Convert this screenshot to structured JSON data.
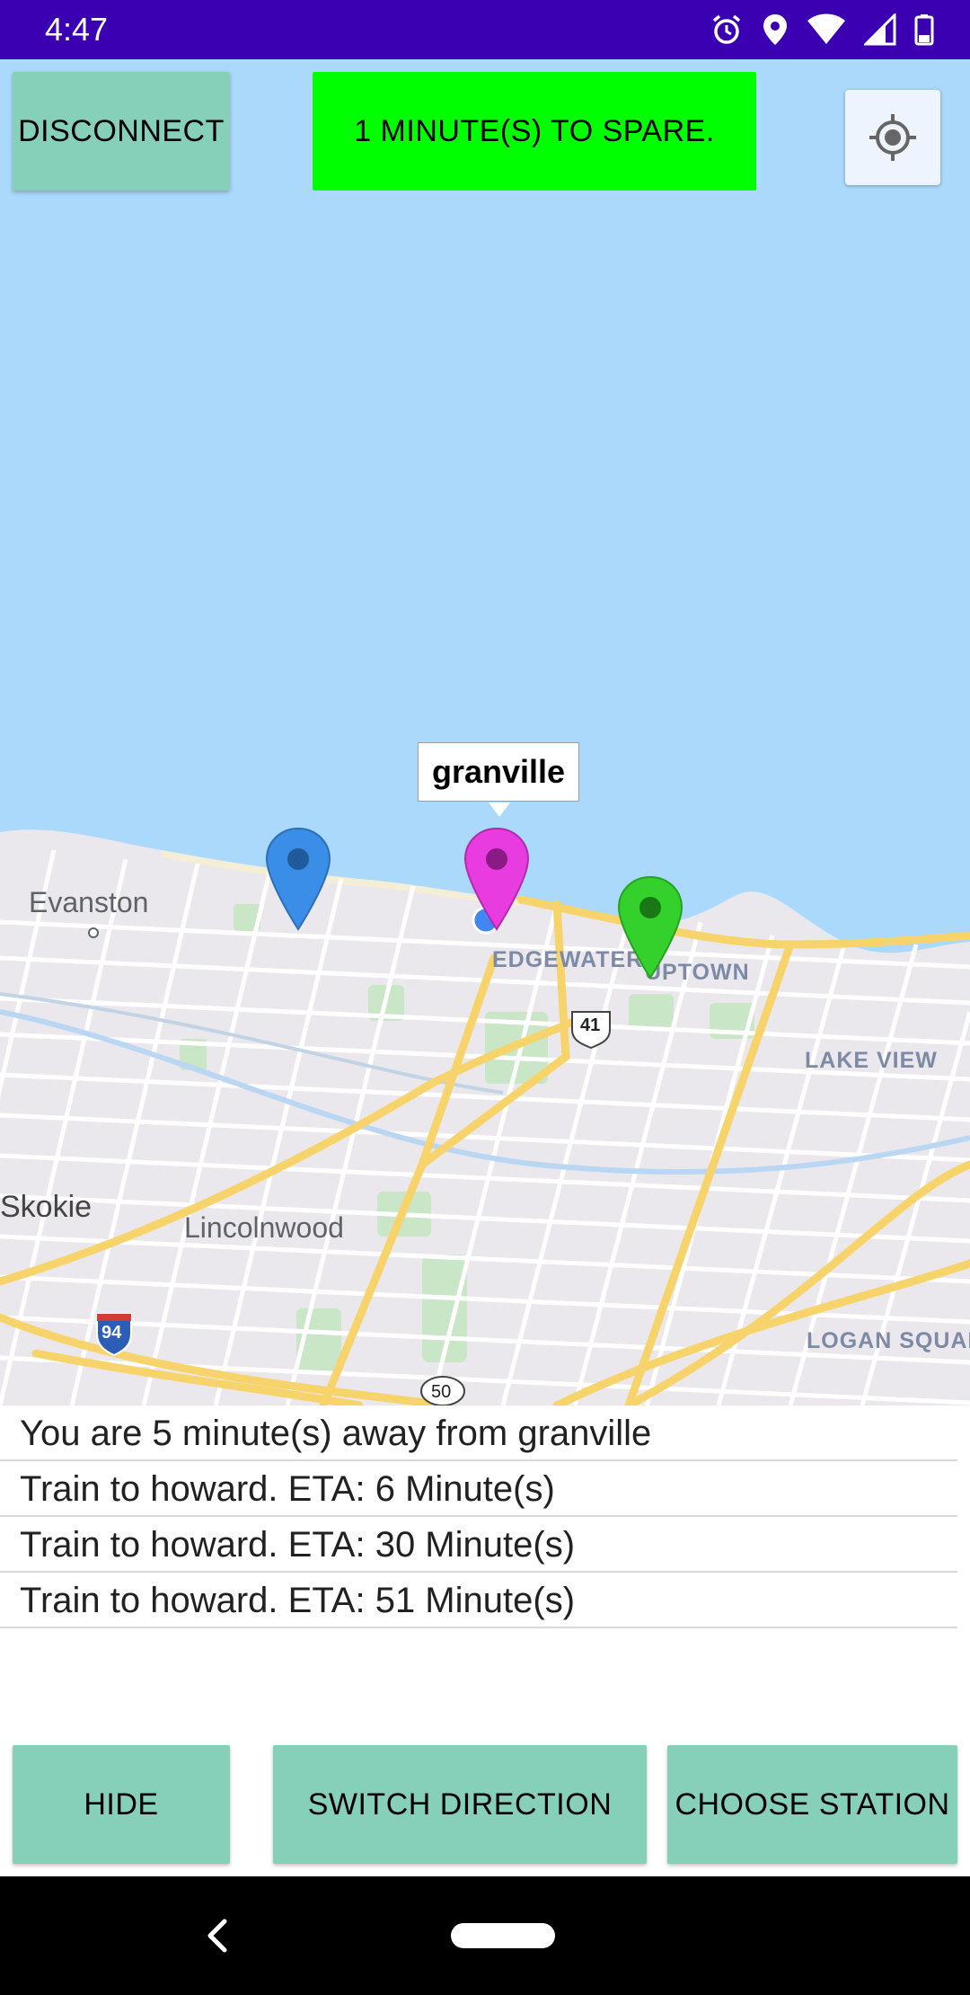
{
  "status_bar": {
    "time": "4:47",
    "icons": [
      "alarm-icon",
      "location-icon",
      "wifi-icon",
      "signal-icon",
      "battery-icon"
    ]
  },
  "map": {
    "disconnect_label": "DISCONNECT",
    "spare_banner": "1 MINUTE(S) TO SPARE.",
    "spare_banner_color": "#00ff00",
    "info_window_title": "granville",
    "place_labels": {
      "evanston": "Evanston",
      "edgewater": "EDGEWATER",
      "uptown": "UPTOWN",
      "lake_view": "LAKE VIEW",
      "skokie": "Skokie",
      "lincolnwood": "Lincolnwood",
      "logan_square": "LOGAN SQUAR",
      "route_41": "41",
      "route_94": "94",
      "route_50": "50"
    },
    "markers": [
      {
        "name": "blue-marker",
        "color": "#3a8ee6"
      },
      {
        "name": "granville-marker",
        "color": "#e83be0"
      },
      {
        "name": "green-marker",
        "color": "#34d12c"
      }
    ]
  },
  "arrivals": {
    "summary": "You are 5 minute(s) away from granville",
    "trains": [
      "Train to howard. ETA: 6 Minute(s)",
      "Train to howard. ETA: 30 Minute(s)",
      "Train to howard. ETA: 51 Minute(s)"
    ]
  },
  "controls": {
    "hide_label": "HIDE",
    "switch_label": "SWITCH DIRECTION",
    "choose_label": "CHOOSE STATION",
    "button_color": "#86cfb9"
  }
}
